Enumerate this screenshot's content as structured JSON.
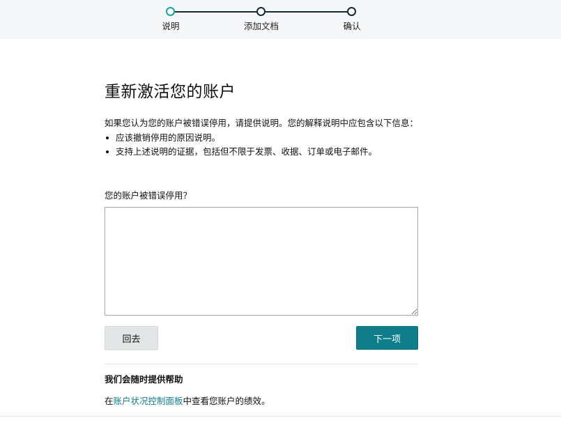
{
  "stepper": {
    "steps": [
      {
        "label": "说明",
        "state": "active"
      },
      {
        "label": "添加文档",
        "state": "upcoming"
      },
      {
        "label": "确认",
        "state": "upcoming"
      }
    ]
  },
  "main": {
    "title": "重新激活您的账户",
    "intro": "如果您认为您的账户被错误停用，请提供说明。您的解释说明中应包含以下信息：",
    "bullets": [
      "应该撤销停用的原因说明。",
      "支持上述说明的证据，包括但不限于发票、收据、订单或电子邮件。"
    ],
    "question": "您的账户被错误停用？",
    "answer_value": "",
    "back_label": "回去",
    "next_label": "下一项"
  },
  "help": {
    "title": "我们会随时提供帮助",
    "text_prefix": "在",
    "link_label": "账户状况控制面板",
    "text_suffix": "中查看您账户的绩效。"
  },
  "colors": {
    "accent": "#0f7e8a",
    "active_step": "#17a2a2",
    "step_line": "#0f2a35"
  }
}
